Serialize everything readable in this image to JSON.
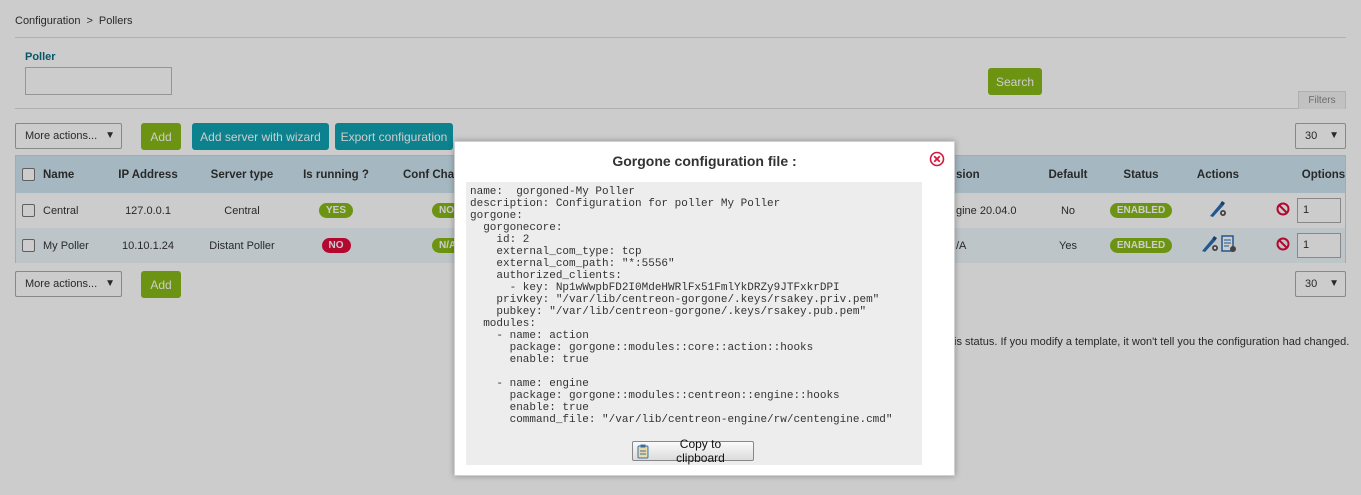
{
  "breadcrumb": {
    "items": [
      "Configuration",
      "Pollers"
    ],
    "separator": ">"
  },
  "filter": {
    "label": "Poller",
    "value": "",
    "search_label": "Search",
    "filters_tab": "Filters"
  },
  "toolbar_top": {
    "more_actions": "More actions...",
    "add": "Add",
    "add_wizard": "Add server with wizard",
    "export": "Export configuration",
    "page_size": "30"
  },
  "toolbar_bottom": {
    "more_actions": "More actions...",
    "add": "Add",
    "page_size": "30"
  },
  "table": {
    "columns": [
      "Name",
      "IP Address",
      "Server type",
      "Is running ?",
      "Conf Cha",
      "sion",
      "Default",
      "Status",
      "Actions",
      "Options"
    ],
    "rows": [
      {
        "name": "Central",
        "ip": "127.0.0.1",
        "type": "Central",
        "running": "YES",
        "conf": "NO",
        "version": "gine 20.04.0",
        "default": "No",
        "status": "ENABLED",
        "option": "1"
      },
      {
        "name": "My Poller",
        "ip": "10.10.1.24",
        "type": "Distant Poller",
        "running": "NO",
        "conf": "N/A",
        "version": "/A",
        "default": "Yes",
        "status": "ENABLED",
        "option": "1"
      }
    ]
  },
  "notice": "is status. If you modify a template, it won't tell you the configuration had changed.",
  "modal": {
    "title": "Gorgone configuration file :",
    "copy_label": "Copy to clipboard",
    "code_lines": [
      "name:  gorgoned-My Poller",
      "description: Configuration for poller My Poller",
      "gorgone:",
      "  gorgonecore:",
      "    id: 2",
      "    external_com_type: tcp",
      "    external_com_path: \"*:5556\"",
      "    authorized_clients:",
      "      - key: Np1wWwpbFD2I0MdeHWRlFx51FmlYkDRZy9JTFxkrDPI",
      "    privkey: \"/var/lib/centreon-gorgone/.keys/rsakey.priv.pem\"",
      "    pubkey: \"/var/lib/centreon-gorgone/.keys/rsakey.pub.pem\"",
      "  modules:",
      "    - name: action",
      "      package: gorgone::modules::core::action::hooks",
      "      enable: true",
      "",
      "    - name: engine",
      "      package: gorgone::modules::centreon::engine::hooks",
      "      enable: true",
      "      command_file: \"/var/lib/centreon-engine/rw/centengine.cmd\""
    ]
  },
  "colors": {
    "green": "#88b917",
    "teal": "#10a3b2",
    "red": "#e00b3d",
    "header": "#cfe7f3"
  }
}
